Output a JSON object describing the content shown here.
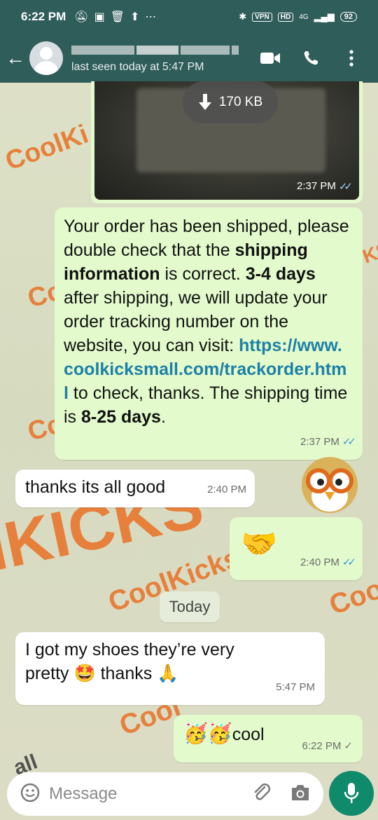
{
  "status_bar": {
    "time": "6:22 PM",
    "left_icons": [
      "mute-icon",
      "message-icon",
      "delete-icon",
      "upload-icon",
      "more-dots-icon"
    ],
    "vpn": "VPN",
    "hd": "HD",
    "network": "4G",
    "battery": "92"
  },
  "header": {
    "last_seen": "last seen today at 5:47 PM"
  },
  "messages": {
    "image": {
      "size": "170 KB",
      "time": "2:37 PM"
    },
    "shipped": {
      "p1": "Your order has been shipped, please double check that the ",
      "b1": "shipping information",
      "p2": " is correct. ",
      "b2": "3-4 days",
      "p3": " after shipping, we will update your order tracking number on the website, you can visit: ",
      "link": "https://www.coolkicksmall.com/trackorder.html",
      "p4": " to check, thanks. The shipping time is ",
      "b3": "8-25 days",
      "p5": ".",
      "time": "2:37 PM"
    },
    "thanks": {
      "text": "thanks its all good",
      "time": "2:40 PM"
    },
    "handshake": {
      "emoji": "🤝",
      "time": "2:40 PM"
    },
    "date_chip": "Today",
    "shoes": {
      "text1": "I got my shoes they’re very",
      "text2a": "pretty ",
      "emoji1": "🤩",
      "text2b": " thanks ",
      "emoji2": "🙏",
      "time": "5:47 PM"
    },
    "cool": {
      "emoji": "🥳🥳",
      "text": "cool",
      "time": "6:22 PM"
    }
  },
  "input": {
    "placeholder": "Message"
  },
  "watermarks": [
    "CoolKi",
    "Cool",
    "IKICKS",
    "CoolKicksM",
    "Coo",
    "KS",
    "Cc",
    "Cc",
    "all"
  ],
  "colors": {
    "header": "#2f5d5a",
    "outgoing": "#e3fbcc",
    "incoming": "#ffffff",
    "accent": "#0f8a6b",
    "watermark": "#e8772e"
  }
}
